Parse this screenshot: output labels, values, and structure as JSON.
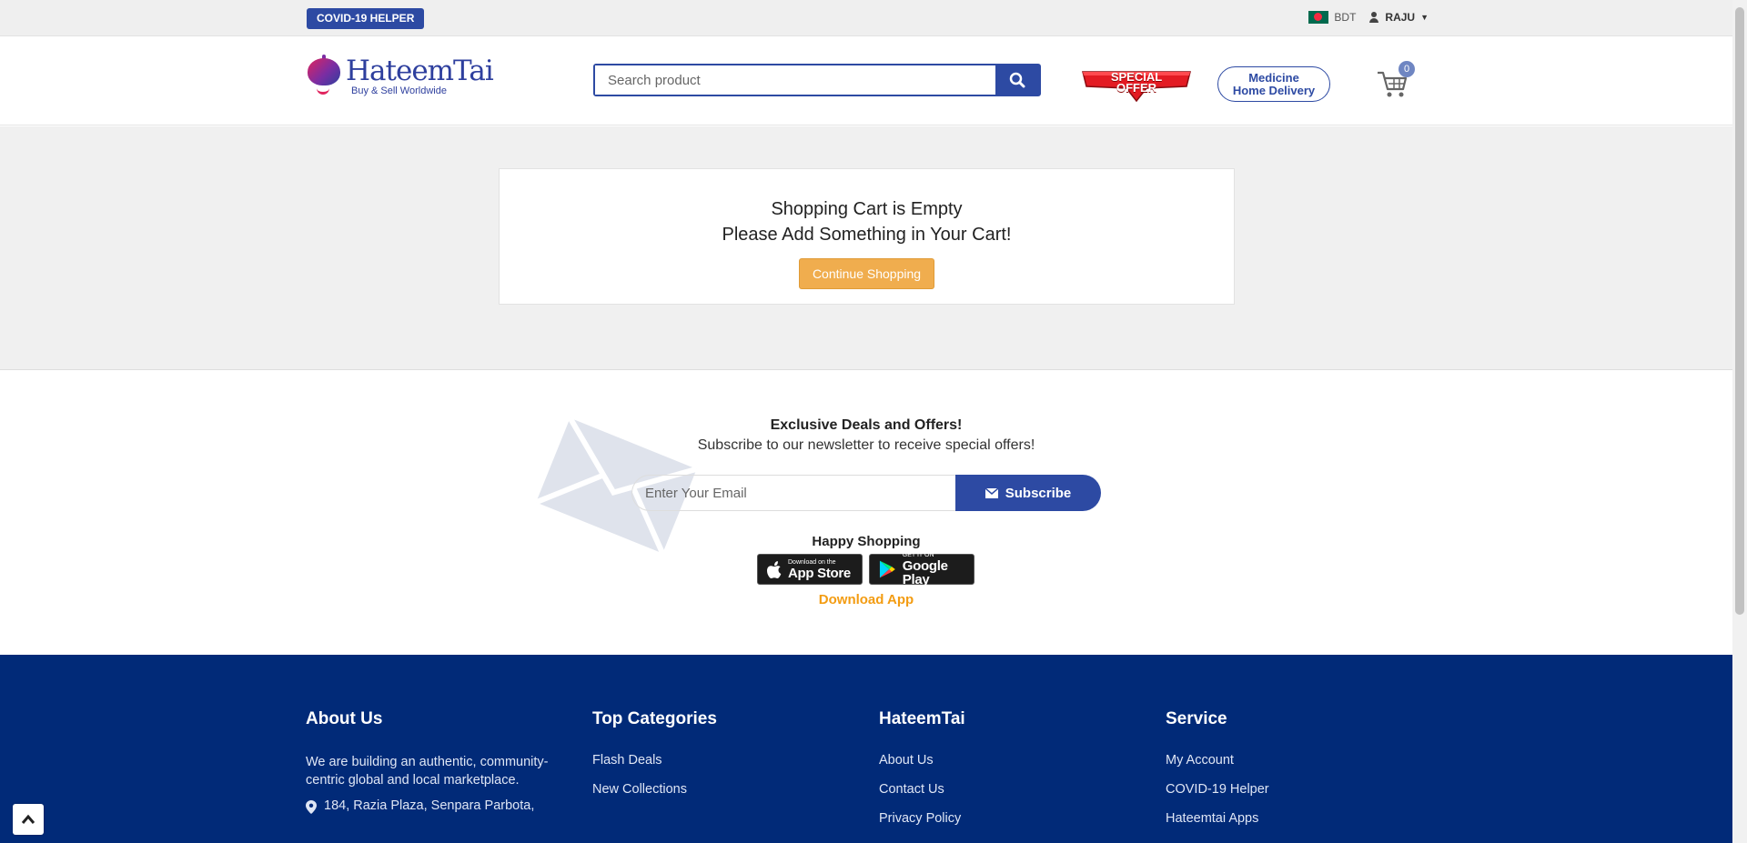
{
  "topbar": {
    "covid_label": "COVID-19 HELPER",
    "currency": "BDT",
    "user": "RAJU"
  },
  "header": {
    "logo_name": "HateemTai",
    "logo_tagline": "Buy & Sell Worldwide",
    "search_placeholder": "Search product",
    "special_offer_line1": "SPECIAL",
    "special_offer_line2": "OFFER",
    "medicine_line1": "Medicine",
    "medicine_line2": "Home Delivery",
    "cart_count": "0"
  },
  "cart": {
    "empty_line1": "Shopping Cart is Empty",
    "empty_line2": "Please Add Something in Your Cart!",
    "continue_label": "Continue Shopping"
  },
  "newsletter": {
    "title": "Exclusive Deals and Offers!",
    "subtitle": "Subscribe to our newsletter to receive special offers!",
    "email_placeholder": "Enter Your Email",
    "subscribe_label": "Subscribe",
    "happy": "Happy Shopping",
    "appstore_small": "Download on the",
    "appstore_big": "App Store",
    "playstore_small": "GET IT ON",
    "playstore_big": "Google Play",
    "download_app": "Download App"
  },
  "footer": {
    "about_title": "About Us",
    "about_text": "We are building an authentic, community-centric global and local marketplace.",
    "address": "184, Razia Plaza, Senpara Parbota,",
    "categories_title": "Top Categories",
    "categories": [
      "Flash Deals",
      "New Collections"
    ],
    "hateemtai_title": "HateemTai",
    "hateemtai_links": [
      "About Us",
      "Contact Us",
      "Privacy Policy"
    ],
    "service_title": "Service",
    "service_links": [
      "My Account",
      "COVID-19 Helper",
      "Hateemtai Apps"
    ]
  },
  "colors": {
    "primary": "#2d4aa3",
    "footer_bg": "#012a78",
    "accent_orange": "#f0ad4e",
    "download_orange": "#f39c12",
    "special_red": "#e31b23"
  }
}
